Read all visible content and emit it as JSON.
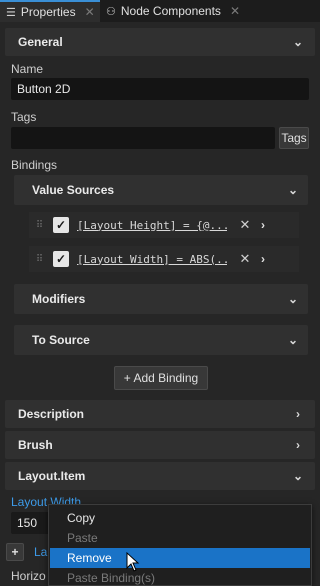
{
  "tabs": [
    {
      "label": "Properties",
      "icon": "list-icon"
    },
    {
      "label": "Node Components",
      "icon": "components-icon"
    }
  ],
  "sections": {
    "general": "General",
    "description": "Description",
    "brush": "Brush",
    "layout_item": "Layout.Item"
  },
  "name": {
    "label": "Name",
    "value": "Button 2D"
  },
  "tags": {
    "label": "Tags",
    "value": "",
    "button": "Tags"
  },
  "bindings": {
    "label": "Bindings",
    "value_sources": "Value Sources",
    "rows": [
      {
        "expression": "[Layout Height] = {@..."
      },
      {
        "expression": "[Layout Width] = ABS(..."
      }
    ],
    "modifiers": "Modifiers",
    "to_source": "To Source",
    "add_binding": "+ Add Binding"
  },
  "layout_width": {
    "label": "Layout Width",
    "value": "150"
  },
  "partial": {
    "la": "La",
    "horizo": "Horizo"
  },
  "context_menu": [
    {
      "label": "Copy",
      "state": "normal"
    },
    {
      "label": "Paste",
      "state": "disabled"
    },
    {
      "label": "Remove",
      "state": "selected"
    },
    {
      "label": "Paste Binding(s)",
      "state": "disabled"
    }
  ]
}
